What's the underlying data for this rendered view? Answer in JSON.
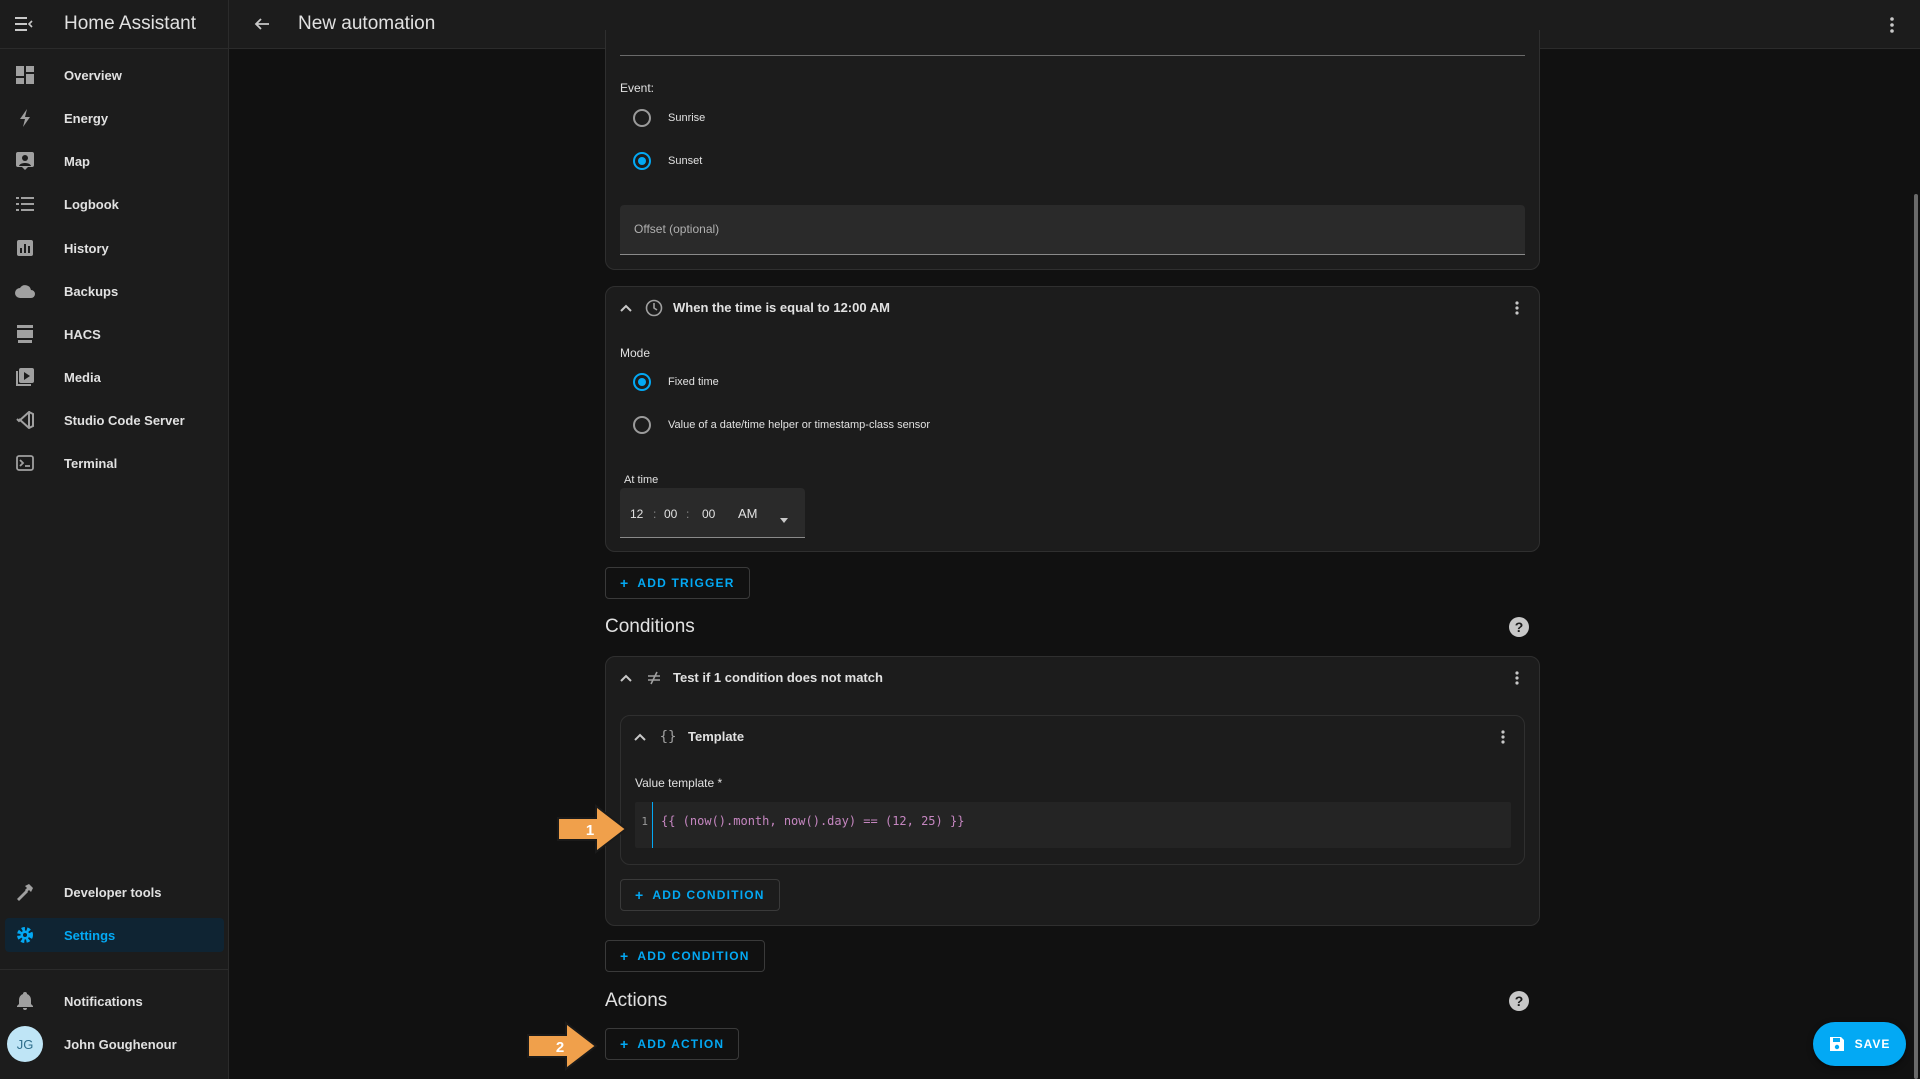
{
  "app": {
    "title": "Home Assistant"
  },
  "topbar": {
    "title": "New automation"
  },
  "sidebar": {
    "items": [
      {
        "label": "Overview",
        "icon": "overview-icon"
      },
      {
        "label": "Energy",
        "icon": "energy-icon"
      },
      {
        "label": "Map",
        "icon": "map-icon"
      },
      {
        "label": "Logbook",
        "icon": "logbook-icon"
      },
      {
        "label": "History",
        "icon": "history-icon"
      },
      {
        "label": "Backups",
        "icon": "backups-icon"
      },
      {
        "label": "HACS",
        "icon": "hacs-icon"
      },
      {
        "label": "Media",
        "icon": "media-icon"
      },
      {
        "label": "Studio Code Server",
        "icon": "vscode-icon"
      },
      {
        "label": "Terminal",
        "icon": "terminal-icon"
      }
    ],
    "developer_tools": "Developer tools",
    "settings": "Settings",
    "notifications": "Notifications",
    "user": {
      "name": "John Goughenour",
      "initials": "JG"
    }
  },
  "sun_trigger": {
    "event_label": "Event:",
    "options": [
      "Sunrise",
      "Sunset"
    ],
    "selected": "Sunset",
    "offset_placeholder": "Offset (optional)"
  },
  "time_trigger": {
    "title": "When the time is equal to 12:00 AM",
    "mode_label": "Mode",
    "options": [
      "Fixed time",
      "Value of a date/time helper or timestamp-class sensor"
    ],
    "selected": "Fixed time",
    "at_time_label": "At time",
    "hours": "12",
    "minutes": "00",
    "seconds": "00",
    "ampm": "AM"
  },
  "add_trigger": "ADD TRIGGER",
  "conditions": {
    "title": "Conditions",
    "not_block_title": "Test if 1 condition does not match",
    "template_title": "Template",
    "value_template_label": "Value template *",
    "line_number": "1",
    "code": "{{ (now().month, now().day) == (12, 25) }}",
    "inner_add": "ADD CONDITION",
    "outer_add": "ADD CONDITION"
  },
  "actions": {
    "title": "Actions",
    "add": "ADD ACTION"
  },
  "annotations": {
    "arrow1": "1",
    "arrow2": "2",
    "color": "#f0a04b"
  },
  "save_label": "SAVE",
  "colors": {
    "accent": "#03a9f4",
    "background": "#111111",
    "card": "#1c1c1c"
  }
}
